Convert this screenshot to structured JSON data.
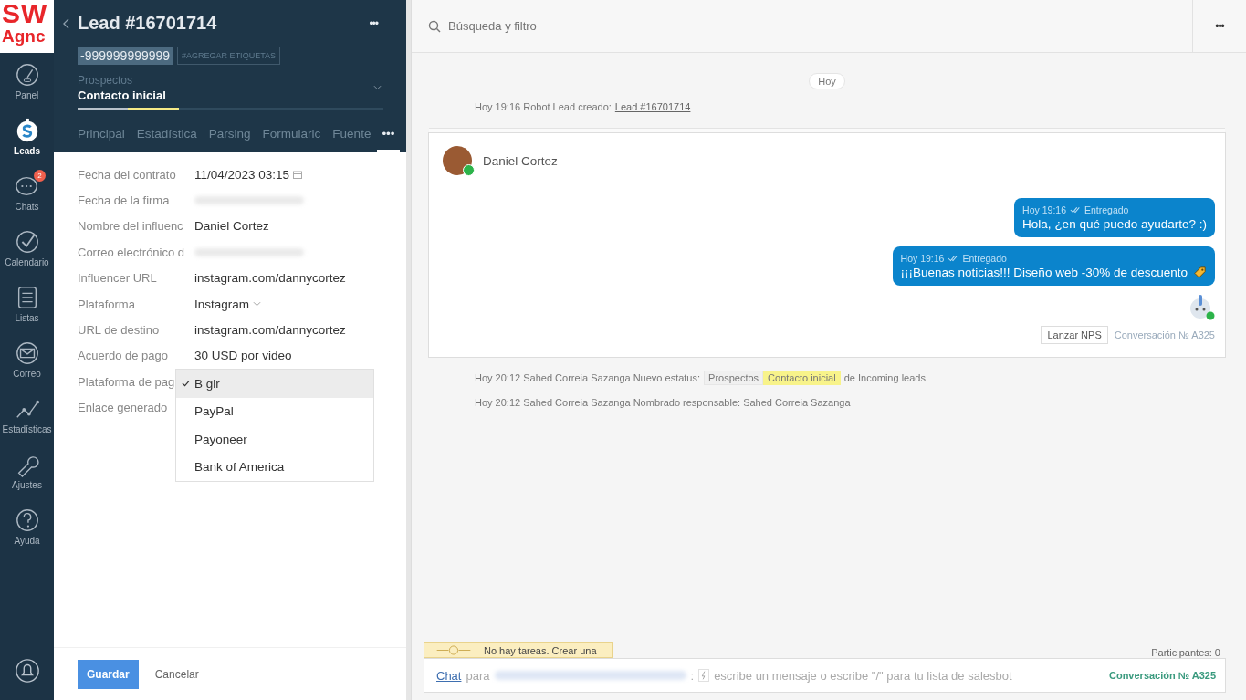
{
  "logo": {
    "line_1": "SW",
    "line_2": "Agnc"
  },
  "nav": [
    {
      "label": "Panel",
      "selected": false
    },
    {
      "label": "Leads",
      "selected": true
    },
    {
      "label": "Chats",
      "selected": false,
      "badge": "2"
    },
    {
      "label": "Calendario",
      "selected": false
    },
    {
      "label": "Listas",
      "selected": false
    },
    {
      "label": "Correo",
      "selected": false
    },
    {
      "label": "Estadísticas",
      "selected": false
    },
    {
      "label": "Ajustes",
      "selected": false
    },
    {
      "label": "Ayuda",
      "selected": false
    }
  ],
  "lead": {
    "title": "Lead #16701714",
    "menu": "•••",
    "tag": "-999999999999",
    "tag_input": "#AGREGAR ETIQUETAS",
    "pipeline": "Prospectos",
    "stage": "Contacto inicial",
    "level": 0.33,
    "tabs": [
      {
        "label": "Principal",
        "selected": false
      },
      {
        "label": "Estadística",
        "selected": false
      },
      {
        "label": "Parsing",
        "selected": false
      },
      {
        "label": "Formularic",
        "selected": false
      },
      {
        "label": "Fuente",
        "selected": false
      },
      {
        "label": "•••",
        "selected": true
      }
    ],
    "fields": [
      {
        "label": "Fecha del contrato",
        "kind": "date",
        "value": "11/04/2023 03:15"
      },
      {
        "label": "Fecha de la firma",
        "kind": "redacted"
      },
      {
        "label": "Nombre del influenc",
        "kind": "text",
        "value": "Daniel Cortez"
      },
      {
        "label": "Correo electrónico d",
        "kind": "redacted"
      },
      {
        "label": "Influencer URL",
        "kind": "text",
        "value": "instagram.com/dannycortez"
      },
      {
        "label": "Plataforma",
        "kind": "select",
        "value": "Instagram"
      },
      {
        "label": "URL de destino",
        "kind": "text",
        "value": "instagram.com/dannycortez"
      },
      {
        "label": "Acuerdo de pago",
        "kind": "text",
        "value": "30 USD por video"
      },
      {
        "label": "Plataforma de pag",
        "kind": "dropdown",
        "options": [
          {
            "label": "B gir",
            "selected": true
          },
          {
            "label": "PayPal",
            "selected": false
          },
          {
            "label": "Payoneer",
            "selected": false
          },
          {
            "label": "Bank of America",
            "selected": false
          }
        ]
      },
      {
        "label": "Enlace generado",
        "kind": "empty"
      }
    ],
    "save": "Guardar",
    "cancel": "Cancelar"
  },
  "search": {
    "placeholder": "Búsqueda y filtro"
  },
  "top_menu": "•••",
  "feed": {
    "date": "Hoy",
    "created": {
      "text": "Hoy 19:16 Robot Lead creado:",
      "link": "Lead #16701714"
    },
    "contact": "Daniel Cortez",
    "messages": [
      {
        "meta": "Hoy 19:16",
        "status": "Entregado",
        "text": "Hola, ¿en qué puedo ayudarte? :)",
        "tag_icon": false
      },
      {
        "meta": "Hoy 19:16",
        "status": "Entregado",
        "text": "¡¡¡Buenas noticias!!! Diseño web -30% de descuento",
        "tag_icon": true
      }
    ],
    "nps": "Lanzar NPS",
    "conversation": "Conversación № A325",
    "status_event": {
      "text": "Hoy 20:12 Sahed Correia Sazanga Nuevo estatus:",
      "pipeline": "Prospectos",
      "stage": "Contacto inicial",
      "suffix": "de Incoming leads"
    },
    "owner_event": "Hoy 20:12 Sahed Correia Sazanga Nombrado responsable: Sahed Correia Sazanga"
  },
  "tasks": "No hay tareas. Crear una",
  "participants": "Participantes: 0",
  "compose": {
    "link": "Chat",
    "to": "para",
    "colon": ":",
    "placeholder": "escribe un mensaje o escribe \"/\" para tu lista de salesbot",
    "conversation": "Conversación № A325"
  }
}
